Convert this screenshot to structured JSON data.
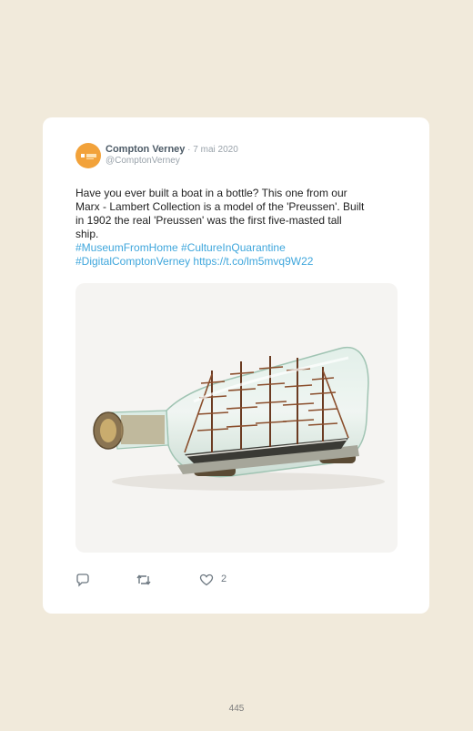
{
  "tweet": {
    "author_name": "Compton Verney",
    "separator": " · ",
    "date": "7 mai 2020",
    "handle": "@ComptonVerney",
    "avatar_icon": "compton-verney-logo",
    "body_lines": [
      "Have you ever built a boat in a bottle? This one from our",
      "Marx - Lambert Collection is a model of the 'Preussen'. Built",
      "in 1902 the real 'Preussen' was the first five-masted tall",
      "ship."
    ],
    "hashtags_line1": "#MuseumFromHome #CultureInQuarantine",
    "hashtags_line2": "#DigitalComptonVerney https://t.co/lm5mvq9W22",
    "image_subject": "ship-in-bottle-photo",
    "likes_count": "2",
    "icons": {
      "reply": "reply-icon",
      "retweet": "retweet-icon",
      "like": "heart-icon"
    }
  },
  "page": {
    "number": "445"
  },
  "colors": {
    "link": "#3ea6dc",
    "background": "#f1eadb",
    "avatar": "#f2a23a"
  }
}
